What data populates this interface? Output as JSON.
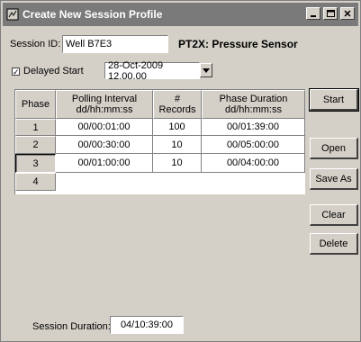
{
  "window": {
    "title": "Create New Session Profile",
    "controls": [
      "minimize-icon",
      "maximize-icon",
      "close-icon"
    ]
  },
  "session": {
    "id_label": "Session ID:",
    "id_value": "Well B7E3",
    "device": "PT2X: Pressure Sensor"
  },
  "delayed_start": {
    "label": "Delayed Start",
    "checked": true,
    "value": "28-Oct-2009 12.00.00"
  },
  "grid": {
    "headers": [
      {
        "line1": "Phase",
        "line2": ""
      },
      {
        "line1": "Polling Interval",
        "line2": "dd/hh:mm:ss"
      },
      {
        "line1": "#",
        "line2": "Records"
      },
      {
        "line1": "Phase Duration",
        "line2": "dd/hh:mm:ss"
      }
    ],
    "rows": [
      {
        "phase": "1",
        "interval": "00/00:01:00",
        "records": "100",
        "duration": "00/01:39:00"
      },
      {
        "phase": "2",
        "interval": "00/00:30:00",
        "records": "10",
        "duration": "00/05:00:00"
      },
      {
        "phase": "3",
        "interval": "00/01:00:00",
        "records": "10",
        "duration": "00/04:00:00"
      },
      {
        "phase": "4",
        "interval": "",
        "records": "",
        "duration": ""
      }
    ]
  },
  "buttons": {
    "start": "Start",
    "open": "Open",
    "save_as": "Save As",
    "clear": "Clear",
    "delete": "Delete"
  },
  "footer": {
    "duration_label": "Session Duration:",
    "duration_value": "04/10:39:00"
  }
}
